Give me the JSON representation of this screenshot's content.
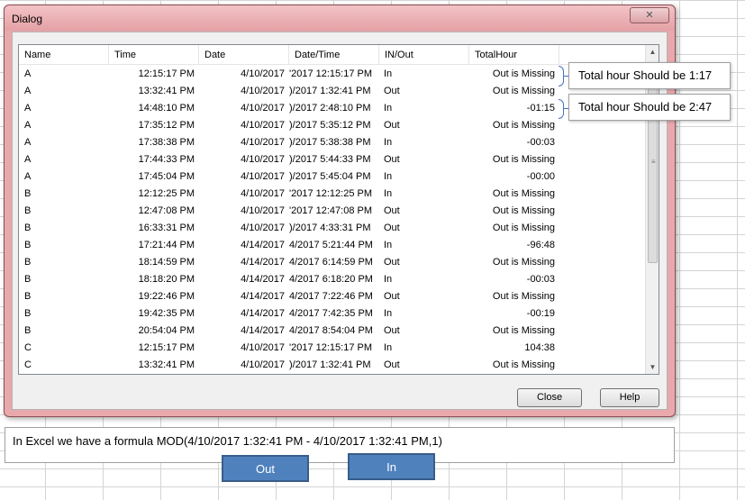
{
  "dialog": {
    "title": "Dialog",
    "close_label": "✕",
    "columns": [
      "Name",
      "Time",
      "Date",
      "Date/Time",
      "IN/Out",
      "TotalHour"
    ],
    "rows": [
      [
        "A",
        "12:15:17 PM",
        "4/10/2017",
        "'2017 12:15:17 PM",
        "In",
        "Out is Missing"
      ],
      [
        "A",
        "13:32:41 PM",
        "4/10/2017",
        ")/2017 1:32:41 PM",
        "Out",
        "Out is Missing"
      ],
      [
        "A",
        "14:48:10 PM",
        "4/10/2017",
        ")/2017 2:48:10 PM",
        "In",
        "-01:15"
      ],
      [
        "A",
        "17:35:12 PM",
        "4/10/2017",
        ")/2017 5:35:12 PM",
        "Out",
        "Out is Missing"
      ],
      [
        "A",
        "17:38:38 PM",
        "4/10/2017",
        ")/2017 5:38:38 PM",
        "In",
        "-00:03"
      ],
      [
        "A",
        "17:44:33 PM",
        "4/10/2017",
        ")/2017 5:44:33 PM",
        "Out",
        "Out is Missing"
      ],
      [
        "A",
        "17:45:04 PM",
        "4/10/2017",
        ")/2017 5:45:04 PM",
        "In",
        "-00:00"
      ],
      [
        "B",
        "12:12:25 PM",
        "4/10/2017",
        "'2017 12:12:25 PM",
        "In",
        "Out is Missing"
      ],
      [
        "B",
        "12:47:08 PM",
        "4/10/2017",
        "'2017 12:47:08 PM",
        "Out",
        "Out is Missing"
      ],
      [
        "B",
        "16:33:31 PM",
        "4/10/2017",
        ")/2017 4:33:31 PM",
        "Out",
        "Out is Missing"
      ],
      [
        "B",
        "17:21:44 PM",
        "4/14/2017",
        "4/2017 5:21:44 PM",
        "In",
        "-96:48"
      ],
      [
        "B",
        "18:14:59 PM",
        "4/14/2017",
        "4/2017 6:14:59 PM",
        "Out",
        "Out is Missing"
      ],
      [
        "B",
        "18:18:20 PM",
        "4/14/2017",
        "4/2017 6:18:20 PM",
        "In",
        "-00:03"
      ],
      [
        "B",
        "19:22:46 PM",
        "4/14/2017",
        "4/2017 7:22:46 PM",
        "Out",
        "Out is Missing"
      ],
      [
        "B",
        "19:42:35 PM",
        "4/14/2017",
        "4/2017 7:42:35 PM",
        "In",
        "-00:19"
      ],
      [
        "B",
        "20:54:04 PM",
        "4/14/2017",
        "4/2017 8:54:04 PM",
        "Out",
        "Out is Missing"
      ],
      [
        "C",
        "12:15:17 PM",
        "4/10/2017",
        "'2017 12:15:17 PM",
        "In",
        "104:38"
      ],
      [
        "C",
        "13:32:41 PM",
        "4/10/2017",
        ")/2017 1:32:41 PM",
        "Out",
        "Out is Missing"
      ]
    ],
    "buttons": {
      "close": "Close",
      "help": "Help"
    }
  },
  "callouts": [
    "Total hour  Should be  1:17",
    "Total hour  Should be  2:47"
  ],
  "note": "In Excel we have a formula  MOD(4/10/2017  1:32:41  PM  -  4/10/2017  1:32:41  PM,1)",
  "shape_buttons": {
    "out": "Out",
    "in": "In"
  },
  "colors": {
    "dialog_frame": "#e8a8ac",
    "brace": "#4472c4",
    "shape_fill": "#4f81bd"
  }
}
